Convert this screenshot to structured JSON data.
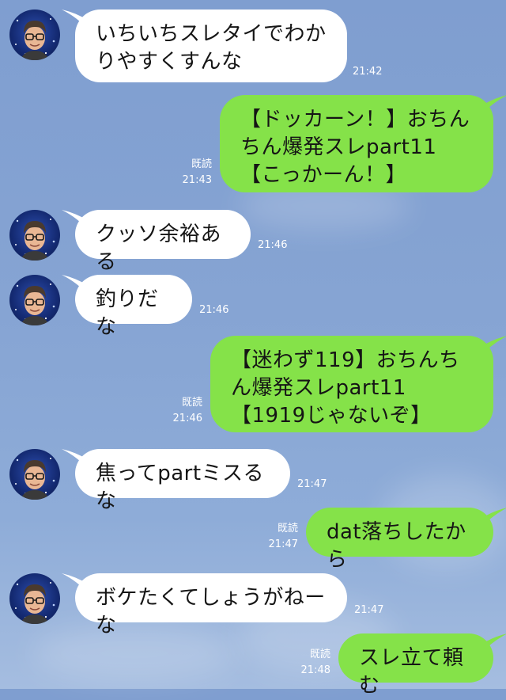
{
  "messages": [
    {
      "side": "in",
      "text": "いちいちスレタイでわかりやすくすんな",
      "time": "21:42"
    },
    {
      "side": "out",
      "text": "【ドッカーン！】おちんちん爆発スレpart11【こっかーん！】",
      "time": "21:43",
      "read": "既読"
    },
    {
      "side": "in",
      "text": "クッソ余裕ある",
      "time": "21:46"
    },
    {
      "side": "in",
      "text": "釣りだな",
      "time": "21:46"
    },
    {
      "side": "out",
      "text": "【迷わず119】おちんちん爆発スレpart11【1919じゃないぞ】",
      "time": "21:46",
      "read": "既読"
    },
    {
      "side": "in",
      "text": "焦ってpartミスるな",
      "time": "21:47"
    },
    {
      "side": "out",
      "text": "dat落ちしたから",
      "time": "21:47",
      "read": "既読"
    },
    {
      "side": "in",
      "text": "ボケたくてしょうがねーな",
      "time": "21:47"
    },
    {
      "side": "out",
      "text": "スレ立て頼む",
      "time": "21:48",
      "read": "既読"
    }
  ],
  "colors": {
    "incoming_bubble": "#ffffff",
    "outgoing_bubble": "#85e249",
    "background": "#86a4d3"
  }
}
